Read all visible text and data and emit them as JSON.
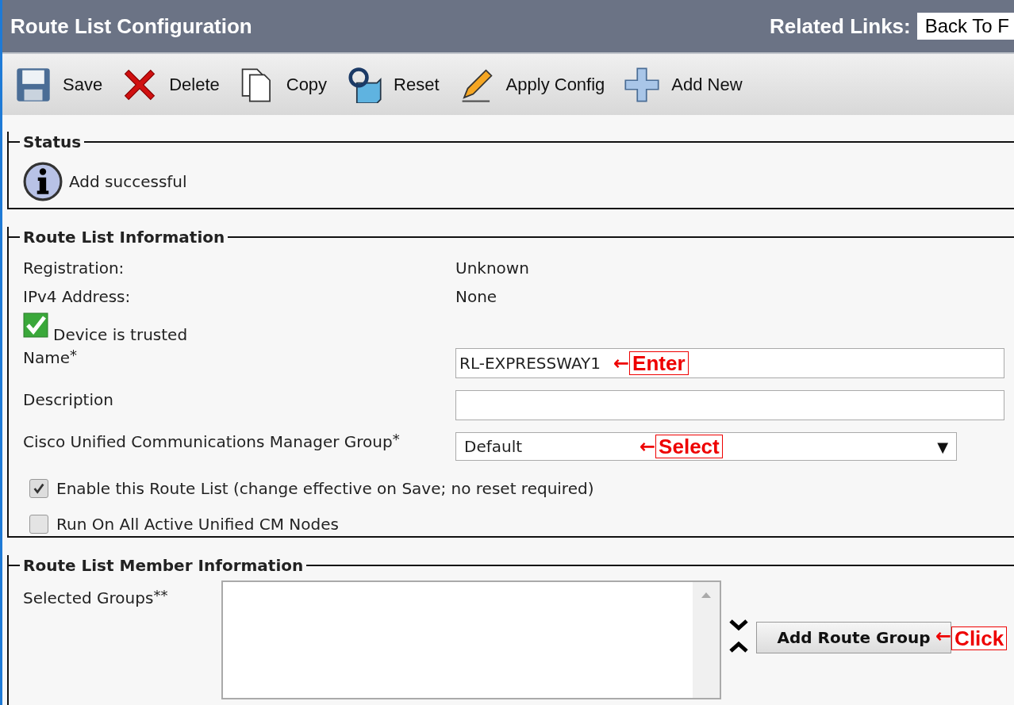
{
  "header": {
    "title": "Route List Configuration",
    "related_links_label": "Related Links:",
    "related_links_value": "Back To F"
  },
  "toolbar": [
    {
      "kind": "save",
      "label": "Save"
    },
    {
      "kind": "delete",
      "label": "Delete"
    },
    {
      "kind": "copy",
      "label": "Copy"
    },
    {
      "kind": "reset",
      "label": "Reset"
    },
    {
      "kind": "apply",
      "label": "Apply Config"
    },
    {
      "kind": "add",
      "label": "Add New"
    }
  ],
  "status": {
    "legend": "Status",
    "message": "Add successful"
  },
  "route_list_info": {
    "legend": "Route List Information",
    "rows": [
      {
        "label": "Registration:",
        "value": "Unknown"
      },
      {
        "label": "IPv4 Address:",
        "value": "None"
      }
    ],
    "trusted": {
      "label": "Device is trusted",
      "checked": true
    },
    "name": {
      "label": "Name",
      "mark": "*",
      "value": "RL-EXPRESSWAY1",
      "annotation": {
        "arrow": "←",
        "text": "Enter"
      }
    },
    "description": {
      "label": "Description"
    },
    "group": {
      "label": "Cisco Unified Communications Manager Group",
      "mark": "*",
      "value": "Default",
      "caret": "▼",
      "annotation": {
        "arrow": "←",
        "text": "Select"
      }
    },
    "checkboxes": [
      {
        "label": "Enable this Route List (change effective on Save; no reset required)",
        "checked": true
      },
      {
        "label": "Run On All Active Unified CM Nodes",
        "checked": false
      }
    ]
  },
  "member_info": {
    "legend": "Route List Member Information",
    "selected_groups_label": "Selected Groups",
    "mark": "**",
    "add_button": "Add Route Group",
    "annotation": {
      "arrow": "←",
      "text": "Click"
    }
  }
}
